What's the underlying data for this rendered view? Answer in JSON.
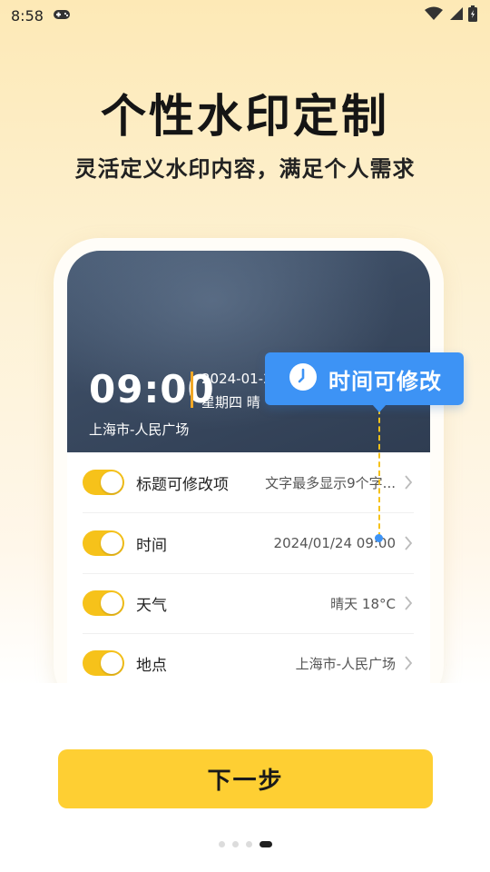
{
  "status_bar": {
    "time": "8:58",
    "left_icons": [
      "gamepad-icon"
    ],
    "right_icons": [
      "wifi-icon",
      "signal-icon",
      "battery-icon"
    ]
  },
  "onboarding": {
    "headline": "个性水印定制",
    "subheadline": "灵活定义水印内容，满足个人需求"
  },
  "watermark_preview": {
    "time": "09:00",
    "date": "2024-01-2",
    "weekday_weather": "星期四 晴",
    "location": "上海市-人民广场",
    "accent_color": "#f0a726"
  },
  "tooltip": {
    "icon": "clock-icon",
    "text": "时间可修改",
    "color": "#3d93f5"
  },
  "settings": [
    {
      "label": "标题可修改项",
      "value": "文字最多显示9个字...",
      "enabled": true
    },
    {
      "label": "时间",
      "value": "2024/01/24  09:00",
      "enabled": true
    },
    {
      "label": "天气",
      "value": "晴天 18°C",
      "enabled": true
    },
    {
      "label": "地点",
      "value": "上海市-人民广场",
      "enabled": true
    }
  ],
  "toggle_color": "#f6c21a",
  "next_button": {
    "label": "下一步",
    "color": "#fecf33"
  },
  "pager": {
    "total": 4,
    "current": 4
  }
}
